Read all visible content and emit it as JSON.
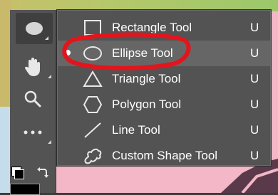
{
  "toolbar": {
    "tools": [
      {
        "name": "ellipse-tool-icon",
        "active": true
      },
      {
        "name": "hand-icon",
        "active": false
      },
      {
        "name": "zoom-icon",
        "active": false
      },
      {
        "name": "more-tools-icon",
        "active": false
      }
    ],
    "colors": {
      "foreground": "#000000",
      "background": "#ffffff"
    }
  },
  "flyout": {
    "items": [
      {
        "label": "Rectangle Tool",
        "shortcut": "U",
        "icon": "rectangle-icon",
        "selected": false,
        "checked": false
      },
      {
        "label": "Ellipse Tool",
        "shortcut": "U",
        "icon": "ellipse-icon",
        "selected": true,
        "checked": true
      },
      {
        "label": "Triangle Tool",
        "shortcut": "U",
        "icon": "triangle-icon",
        "selected": false,
        "checked": false
      },
      {
        "label": "Polygon Tool",
        "shortcut": "U",
        "icon": "polygon-icon",
        "selected": false,
        "checked": false
      },
      {
        "label": "Line Tool",
        "shortcut": "U",
        "icon": "line-icon",
        "selected": false,
        "checked": false
      },
      {
        "label": "Custom Shape Tool",
        "shortcut": "U",
        "icon": "custom-shape-icon",
        "selected": false,
        "checked": false
      }
    ]
  },
  "annotation": {
    "color": "#e3141c",
    "target": "Ellipse Tool"
  },
  "theme": {
    "panel": "#535353",
    "highlight": "#666666",
    "text": "#ffffff",
    "canvas_pink": "#f4b7c8"
  }
}
